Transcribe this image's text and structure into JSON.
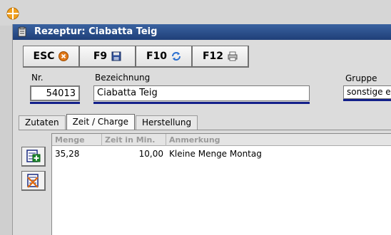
{
  "window": {
    "title": "Rezeptur: Ciabatta Teig"
  },
  "toolbar": {
    "buttons": [
      {
        "label": "ESC",
        "icon": "cancel-icon"
      },
      {
        "label": "F9",
        "icon": "save-icon"
      },
      {
        "label": "F10",
        "icon": "refresh-icon"
      },
      {
        "label": "F12",
        "icon": "print-icon"
      }
    ]
  },
  "form": {
    "nr_label": "Nr.",
    "nr_value": "54013",
    "bezeichnung_label": "Bezeichnung",
    "bezeichnung_value": "Ciabatta Teig",
    "gruppe_label": "Gruppe",
    "gruppe_value": "sonstige e"
  },
  "tabs": [
    {
      "label": "Zutaten",
      "active": false
    },
    {
      "label": "Zeit / Charge",
      "active": true
    },
    {
      "label": "Herstellung",
      "active": false
    }
  ],
  "side_actions": [
    {
      "icon": "add-row-icon"
    },
    {
      "icon": "delete-row-icon"
    }
  ],
  "grid": {
    "columns": [
      "Menge",
      "Zeit in Min.",
      "Anmerkung"
    ],
    "rows": [
      [
        "35,28",
        "10,00",
        "Kleine Menge Montag"
      ]
    ]
  },
  "colors": {
    "title_bar": "#2b4f8c",
    "field_underline": "#13208a",
    "app_icon": "#f0a020"
  }
}
